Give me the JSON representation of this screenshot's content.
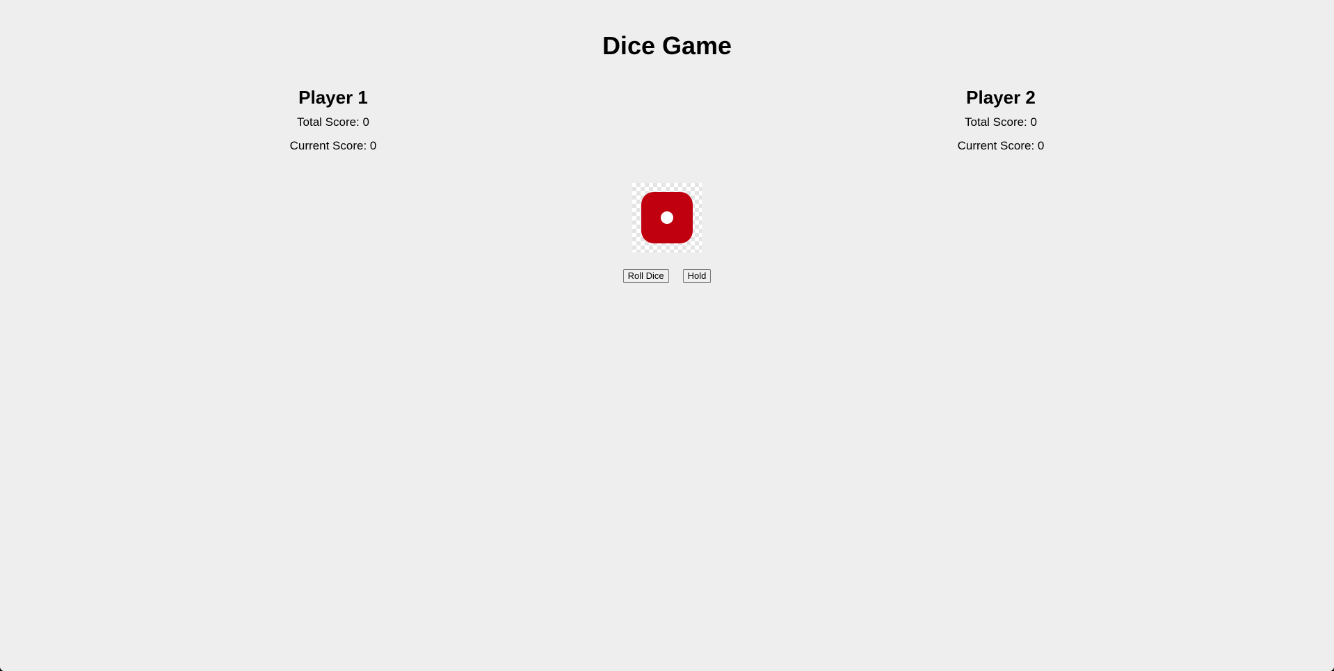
{
  "game": {
    "title": "Dice Game"
  },
  "players": [
    {
      "name": "Player 1",
      "total_label": "Total Score: ",
      "total_score": "0",
      "current_label": "Current Score: ",
      "current_score": "0"
    },
    {
      "name": "Player 2",
      "total_label": "Total Score: ",
      "total_score": "0",
      "current_label": "Current Score: ",
      "current_score": "0"
    }
  ],
  "dice": {
    "value": 1,
    "icon": "die-face-one-icon",
    "face_color": "#c0000e",
    "pip_color": "#ffffff"
  },
  "controls": {
    "roll_label": "Roll Dice",
    "hold_label": "Hold"
  }
}
